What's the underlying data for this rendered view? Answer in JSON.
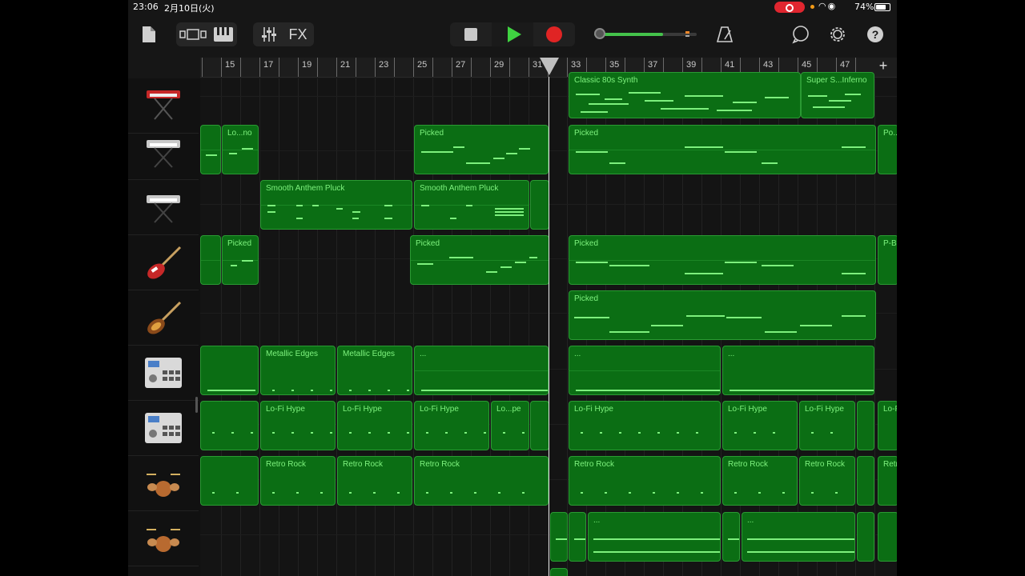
{
  "status": {
    "time": "23:06",
    "date": "2月10日(火)",
    "battery": "74%"
  },
  "toolbar": {
    "fx_label": "FX",
    "colors": {
      "play": "#3fd341",
      "record": "#e02424",
      "region": "#0b6e14",
      "note": "#7df07d"
    }
  },
  "ruler": {
    "numbers": [
      "15",
      "17",
      "19",
      "21",
      "23",
      "25",
      "27",
      "29",
      "31",
      "33",
      "35",
      "37",
      "39",
      "41",
      "43",
      "45",
      "47"
    ],
    "add_label": "+"
  },
  "tracks": [
    {
      "instrument": "synth-keyboard-red-icon"
    },
    {
      "instrument": "synth-keyboard-icon"
    },
    {
      "instrument": "synth-keyboard-icon"
    },
    {
      "instrument": "electric-bass-red-icon"
    },
    {
      "instrument": "electric-bass-sunburst-icon"
    },
    {
      "instrument": "drum-machine-icon"
    },
    {
      "instrument": "drum-machine-icon"
    },
    {
      "instrument": "drum-kit-icon"
    },
    {
      "instrument": "drum-kit-icon"
    }
  ],
  "regions": {
    "t1": [
      "Classic 80s Synth",
      "Super S...Inferno"
    ],
    "t2": [
      "Lo...no",
      "Picked",
      "Picked",
      "Po..."
    ],
    "t3": [
      "Smooth Anthem Pluck",
      "Smooth Anthem Pluck"
    ],
    "t4": [
      "Picked",
      "Picked",
      "Picked",
      "P-Ba..."
    ],
    "t5": [
      "Picked"
    ],
    "t6": [
      "Metallic Edges",
      "Metallic Edges",
      "...",
      "...",
      "..."
    ],
    "t7": [
      "Lo-Fi Hype",
      "Lo-Fi Hype",
      "Lo-Fi Hype",
      "Lo...pe",
      "Lo-Fi Hype",
      "Lo-Fi Hype",
      "Lo-Fi Hype",
      "Lo-Fi"
    ],
    "t8": [
      "Retro Rock",
      "Retro Rock",
      "Retro Rock",
      "Retro Rock",
      "Retro Rock",
      "Retro Rock",
      "Retro"
    ],
    "t9": [
      "...",
      "..."
    ]
  }
}
